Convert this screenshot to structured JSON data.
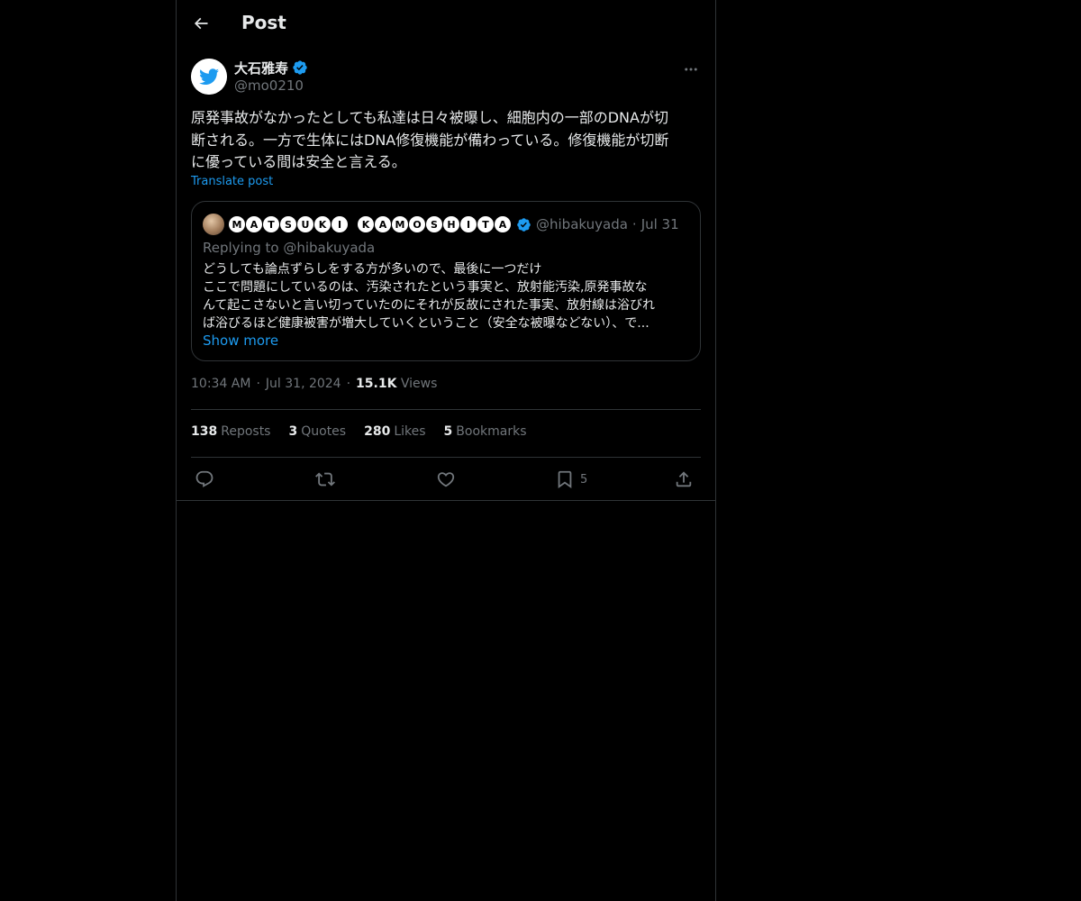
{
  "header": {
    "title": "Post",
    "back_icon": "arrow-left-icon"
  },
  "author": {
    "name": "大石雅寿",
    "handle": "@mo0210",
    "verified": true,
    "avatar_icon": "twitter-bird-icon",
    "more_icon": "more-horizontal-icon"
  },
  "post": {
    "text_lines": [
      "原発事故がなかったとしても私達は日々被曝し、細胞内の一部のDNAが切",
      "断される。一方で生体にはDNA修復機能が備わっている。修復機能が切断",
      "に優っている間は安全と言える。"
    ],
    "translate_label": "Translate post"
  },
  "quote": {
    "name_letters": [
      "M",
      "A",
      "T",
      "S",
      "U",
      "K",
      "I",
      " ",
      "K",
      "A",
      "M",
      "O",
      "S",
      "H",
      "I",
      "T",
      "A"
    ],
    "verified": true,
    "handle": "@hibakuyada",
    "separator": "·",
    "date": "Jul 31",
    "replying_prefix": "Replying to ",
    "replying_to": "@hibakuyada",
    "body_lines": [
      "どうしても論点ずらしをする方が多いので、最後に一つだけ",
      "ここで問題にしているのは、汚染されたという事実と、放射能汚染,原発事故な",
      "んて起こさないと言い切っていたのにそれが反故にされた事実、放射線は浴びれ",
      "ば浴びるほど健康被害が増大していくということ（安全な被曝などない）、で..."
    ],
    "show_more": "Show more"
  },
  "meta": {
    "time": "10:34 AM",
    "separator": "·",
    "date": "Jul 31, 2024",
    "views_count": "15.1K",
    "views_label": "Views"
  },
  "stats": {
    "reposts": {
      "num": "138",
      "label": "Reposts"
    },
    "quotes": {
      "num": "3",
      "label": "Quotes"
    },
    "likes": {
      "num": "280",
      "label": "Likes"
    },
    "bookmarks": {
      "num": "5",
      "label": "Bookmarks"
    }
  },
  "actions": {
    "reply_icon": "reply-icon",
    "repost_icon": "repost-icon",
    "like_icon": "heart-icon",
    "bookmark_icon": "bookmark-icon",
    "bookmark_count": "5",
    "share_icon": "share-icon"
  },
  "colors": {
    "background": "#000000",
    "text": "#e7e9ea",
    "muted": "#71767b",
    "accent": "#1d9bf0",
    "border": "#2f3336"
  }
}
